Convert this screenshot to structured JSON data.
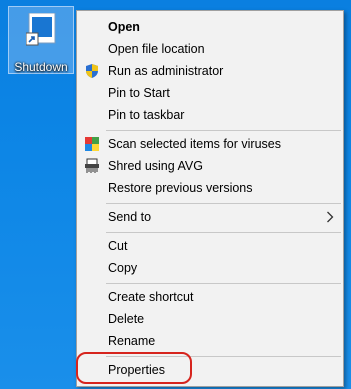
{
  "desktop": {
    "icon": {
      "label": "Shutdown",
      "icon_name": "document-shortcut-icon"
    }
  },
  "context_menu": {
    "items": [
      {
        "label": "Open",
        "bold": true
      },
      {
        "label": "Open file location"
      },
      {
        "label": "Run as administrator",
        "icon": "uac-shield-icon"
      },
      {
        "label": "Pin to Start"
      },
      {
        "label": "Pin to taskbar"
      },
      {
        "label": "Scan selected items for viruses",
        "icon": "avg-icon"
      },
      {
        "label": "Shred using AVG",
        "icon": "shredder-icon"
      },
      {
        "label": "Restore previous versions"
      },
      {
        "label": "Send to",
        "submenu": true
      },
      {
        "label": "Cut"
      },
      {
        "label": "Copy"
      },
      {
        "label": "Create shortcut"
      },
      {
        "label": "Delete"
      },
      {
        "label": "Rename"
      },
      {
        "label": "Properties",
        "highlighted": true
      }
    ]
  },
  "colors": {
    "highlight_ring": "#d6241d",
    "desktop_bg": "#0d86e6"
  }
}
